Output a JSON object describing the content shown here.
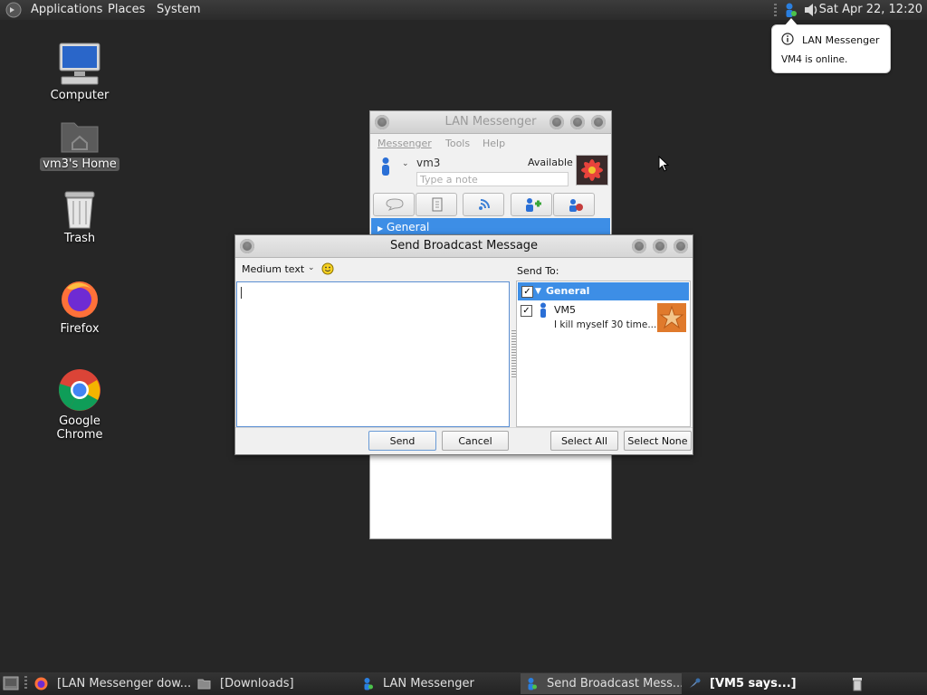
{
  "top_panel": {
    "menus": [
      "Applications",
      "Places",
      "System"
    ],
    "clock": "Sat Apr 22, 12:20"
  },
  "notification": {
    "title": "LAN Messenger",
    "body": "VM4 is online."
  },
  "desktop": {
    "icons": [
      "Computer",
      "vm3's Home",
      "Trash",
      "Firefox",
      "Google Chrome"
    ]
  },
  "lan_messenger": {
    "title": "LAN Messenger",
    "menus": [
      "Messenger",
      "Tools",
      "Help"
    ],
    "username": "vm3",
    "status": "Available",
    "note_placeholder": "Type a note",
    "group": "General"
  },
  "broadcast": {
    "title": "Send Broadcast Message",
    "font_size": "Medium text",
    "message": "",
    "send_to_label": "Send To:",
    "group": "General",
    "group_checked": true,
    "member": {
      "name": "VM5",
      "note": "I kill myself 30 time...",
      "checked": true
    },
    "buttons": {
      "send": "Send",
      "cancel": "Cancel",
      "select_all": "Select All",
      "select_none": "Select None"
    }
  },
  "taskbar": {
    "tasks": [
      {
        "label": "[LAN Messenger dow...",
        "icon": "firefox-icon"
      },
      {
        "label": "[Downloads]",
        "icon": "folder-icon"
      },
      {
        "label": "LAN Messenger",
        "icon": "messenger-icon"
      },
      {
        "label": "Send Broadcast Mess...",
        "icon": "messenger-icon",
        "active": true
      },
      {
        "label": "[VM5 says...]",
        "icon": "chat-icon",
        "bold": true
      }
    ]
  },
  "colors": {
    "accent": "#3d8ee6",
    "desktop": "#262626"
  }
}
